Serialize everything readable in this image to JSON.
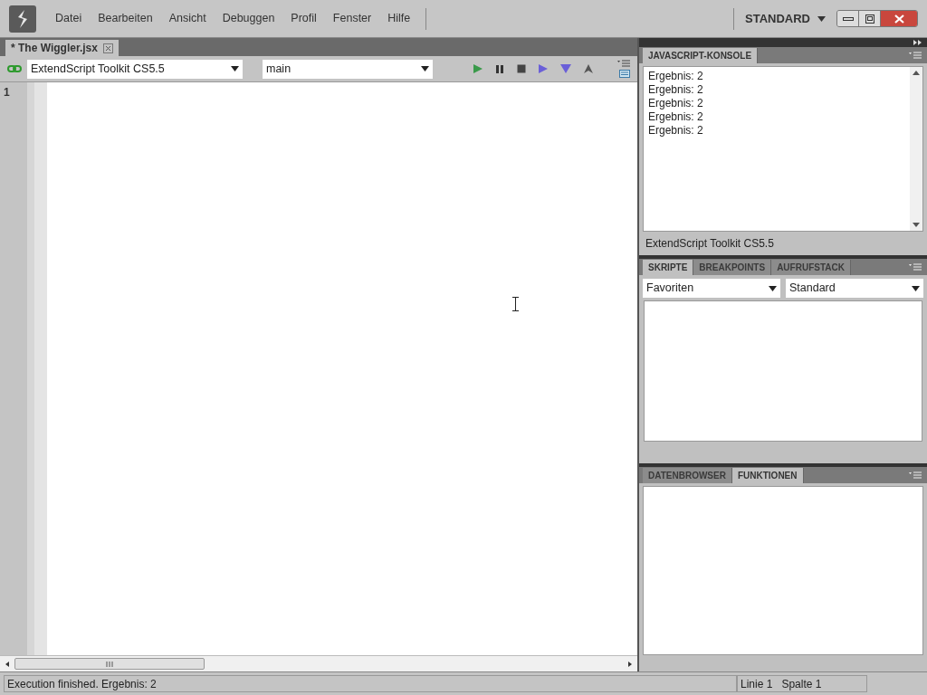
{
  "window": {
    "menu": [
      "Datei",
      "Bearbeiten",
      "Ansicht",
      "Debuggen",
      "Profil",
      "Fenster",
      "Hilfe"
    ],
    "workspace": "STANDARD"
  },
  "editor": {
    "tabs": [
      {
        "label": "* The Wiggler.jsx",
        "selected": true
      }
    ],
    "target": "ExtendScript Toolkit CS5.5",
    "function": "main",
    "line_numbers": [
      "1"
    ]
  },
  "console": {
    "tabs": [
      {
        "label": "JAVASCRIPT-KONSOLE",
        "selected": true
      }
    ],
    "lines": [
      "Ergebnis: 2",
      "Ergebnis: 2",
      "Ergebnis: 2",
      "Ergebnis: 2",
      "Ergebnis: 2"
    ],
    "footer": "ExtendScript Toolkit CS5.5"
  },
  "scripts_panel": {
    "tabs": [
      {
        "label": "SKRIPTE",
        "selected": true
      },
      {
        "label": "BREAKPOINTS",
        "selected": false
      },
      {
        "label": "AUFRUFSTACK",
        "selected": false
      }
    ],
    "source": "Favoriten",
    "scope": "Standard"
  },
  "data_panel": {
    "tabs": [
      {
        "label": "DATENBROWSER",
        "selected": false
      },
      {
        "label": "FUNKTIONEN",
        "selected": true
      }
    ]
  },
  "status_bar": {
    "message": "Execution finished. Ergebnis: 2",
    "line": "Linie 1",
    "column": "Spalte 1"
  }
}
